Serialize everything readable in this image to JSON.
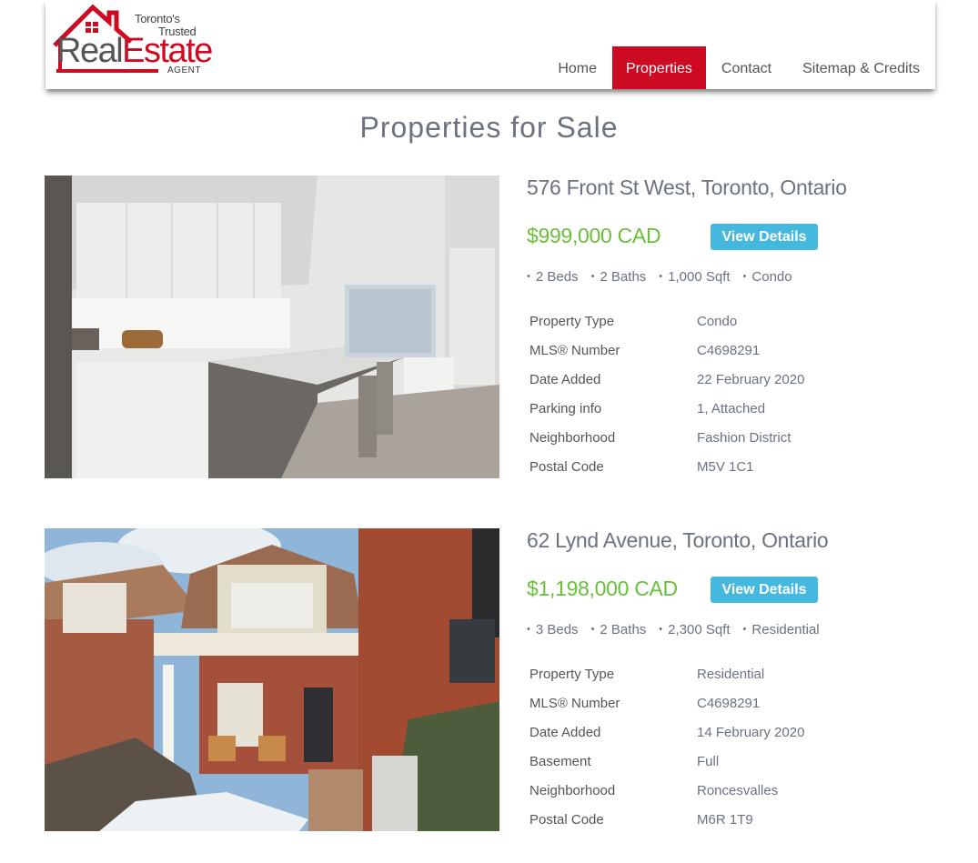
{
  "logo": {
    "tagline_1": "Toronto's",
    "tagline_2": "Trusted",
    "word_real": "Real",
    "word_estate": "Estate",
    "subtitle": "AGENT",
    "brand_color": "#cc0a22"
  },
  "nav": {
    "items": [
      {
        "label": "Home",
        "active": false
      },
      {
        "label": "Properties",
        "active": true
      },
      {
        "label": "Contact",
        "active": false
      },
      {
        "label": "Sitemap & Credits",
        "active": false
      }
    ]
  },
  "page": {
    "title": "Properties for Sale"
  },
  "listings": [
    {
      "address": "576 Front St West, Toronto, Ontario",
      "price": "$999,000 CAD",
      "details_button": "View Details",
      "features": [
        "2 Beds",
        "2 Baths",
        "1,000 Sqft",
        "Condo"
      ],
      "specs": [
        {
          "label": "Property Type",
          "value": "Condo"
        },
        {
          "label": "MLS® Number",
          "value": "C4698291"
        },
        {
          "label": "Date Added",
          "value": "22 February 2020"
        },
        {
          "label": "Parking info",
          "value": "1, Attached"
        },
        {
          "label": "Neighborhood",
          "value": "Fashion District"
        },
        {
          "label": "Postal Code",
          "value": "M5V 1C1"
        }
      ]
    },
    {
      "address": "62 Lynd Avenue, Toronto, Ontario",
      "price": "$1,198,000 CAD",
      "details_button": "View Details",
      "features": [
        "3 Beds",
        "2 Baths",
        "2,300 Sqft",
        "Residential"
      ],
      "specs": [
        {
          "label": "Property Type",
          "value": "Residential"
        },
        {
          "label": "MLS® Number",
          "value": "C4698291"
        },
        {
          "label": "Date Added",
          "value": "14 February 2020"
        },
        {
          "label": "Basement",
          "value": "Full"
        },
        {
          "label": "Neighborhood",
          "value": "Roncesvalles"
        },
        {
          "label": "Postal Code",
          "value": "M6R 1T9"
        }
      ]
    }
  ],
  "colors": {
    "accent_red": "#cc0a22",
    "price_green": "#6abf3a",
    "button_blue": "#45b8dd",
    "text_gray": "#6b7280"
  }
}
